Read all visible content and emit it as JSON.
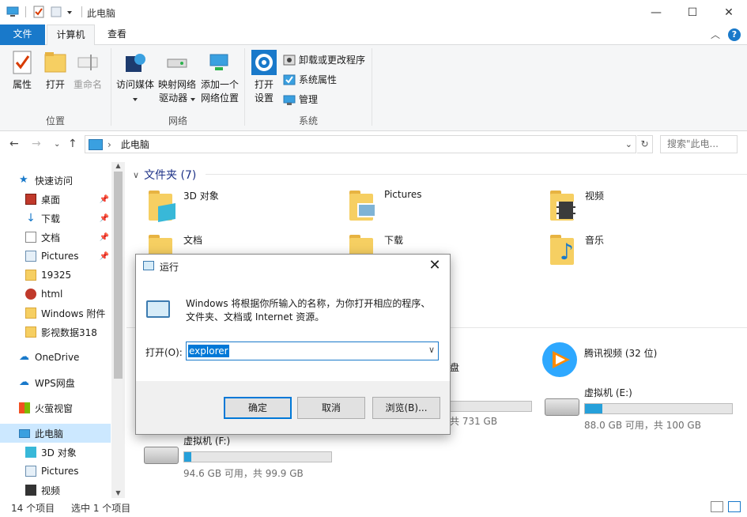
{
  "window": {
    "title": "此电脑"
  },
  "tabs": {
    "file": "文件",
    "computer": "计算机",
    "view": "查看"
  },
  "ribbon": {
    "location": {
      "label": "位置",
      "properties": "属性",
      "open": "打开",
      "rename": "重命名"
    },
    "network": {
      "label": "网络",
      "media": "访问媒体",
      "map_line1": "映射网络",
      "map_line2": "驱动器",
      "add_line1": "添加一个",
      "add_line2": "网络位置"
    },
    "system": {
      "label": "系统",
      "open_line1": "打开",
      "open_line2": "设置",
      "uninstall": "卸载或更改程序",
      "sysprops": "系统属性",
      "manage": "管理"
    }
  },
  "address": {
    "path": "此电脑",
    "search_placeholder": "搜索\"此电..."
  },
  "nav": {
    "quick_access": "快速访问",
    "items": [
      {
        "label": "桌面",
        "pinned": true
      },
      {
        "label": "下载",
        "pinned": true
      },
      {
        "label": "文档",
        "pinned": true
      },
      {
        "label": "Pictures",
        "pinned": true
      },
      {
        "label": "19325",
        "pinned": false
      },
      {
        "label": "html",
        "pinned": false
      },
      {
        "label": "Windows 附件",
        "pinned": false
      },
      {
        "label": "影视数据318",
        "pinned": false
      }
    ],
    "onedrive": "OneDrive",
    "wps": "WPS网盘",
    "huoying": "火萤视窗",
    "this_pc": "此电脑",
    "sub": [
      "3D 对象",
      "Pictures",
      "视频"
    ]
  },
  "content": {
    "folders_header": "文件夹 (7)",
    "folders": [
      "3D 对象",
      "Pictures",
      "视频",
      "文档",
      "下载",
      "音乐"
    ],
    "drives": [
      {
        "name": "腾讯视频 (32 位)",
        "info": "",
        "used": 0
      },
      {
        "name": "虚拟机 (E:)",
        "info": "88.0 GB 可用，共 100 GB",
        "used": 0.12
      },
      {
        "name": "虚拟机 (F:)",
        "info": "94.6 GB 可用，共 99.9 GB",
        "used": 0.05
      }
    ],
    "partial_drive_text": "盘",
    "partial_drive_info": "共 731 GB"
  },
  "status": {
    "items": "14 个项目",
    "selected": "选中 1 个项目"
  },
  "dialog": {
    "title": "运行",
    "description": "Windows 将根据你所输入的名称，为你打开相应的程序、文件夹、文档或 Internet 资源。",
    "open_label": "打开(O):",
    "input_value": "explorer",
    "ok": "确定",
    "cancel": "取消",
    "browse": "浏览(B)..."
  }
}
